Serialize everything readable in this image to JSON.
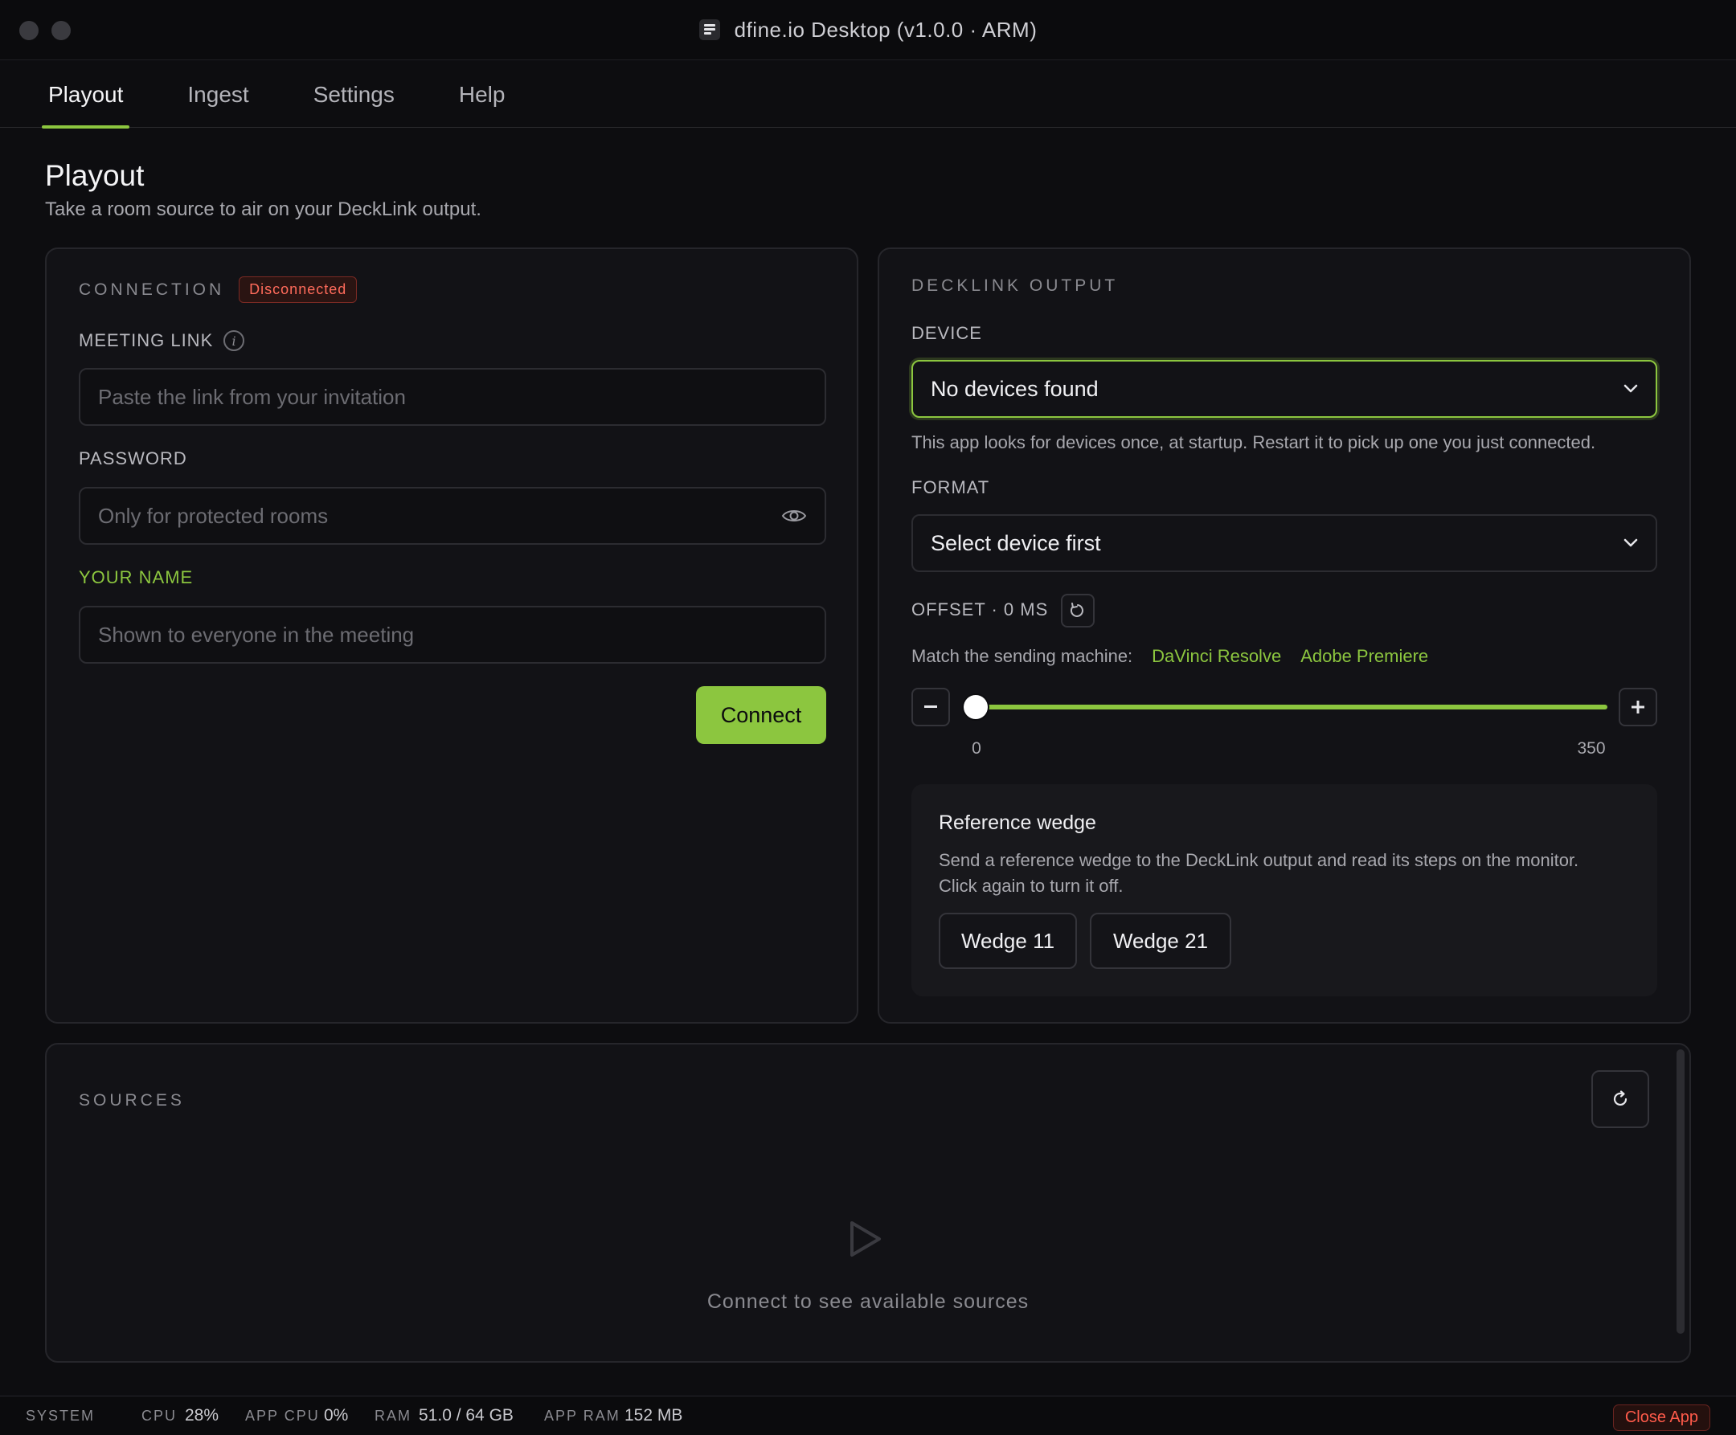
{
  "window": {
    "title": "dfine.io Desktop (v1.0.0 · ARM)"
  },
  "tabs": [
    {
      "label": "Playout"
    },
    {
      "label": "Ingest"
    },
    {
      "label": "Settings"
    },
    {
      "label": "Help"
    }
  ],
  "page": {
    "title": "Playout",
    "subtitle": "Take a room source to air on your DeckLink output."
  },
  "connection": {
    "section_label": "CONNECTION",
    "status_badge": "Disconnected",
    "meeting_link_label": "MEETING LINK",
    "meeting_link_placeholder": "Paste the link from your invitation",
    "password_label": "PASSWORD",
    "password_placeholder": "Only for protected rooms",
    "name_label": "YOUR NAME",
    "name_placeholder": "Shown to everyone in the meeting",
    "connect_label": "Connect"
  },
  "decklink": {
    "section_label": "DECKLINK OUTPUT",
    "device_label": "DEVICE",
    "device_value": "No devices found",
    "device_hint": "This app looks for devices once, at startup. Restart it to pick up one you just connected.",
    "format_label": "FORMAT",
    "format_value": "Select device first",
    "offset_label": "OFFSET · 0 MS",
    "match_label": "Match the sending machine:",
    "match_links": [
      "DaVinci Resolve",
      "Adobe Premiere"
    ],
    "slider": {
      "min": 0,
      "max": 350,
      "value": 0,
      "min_label": "0",
      "max_label": "350"
    },
    "wedge": {
      "title": "Reference wedge",
      "description_1": "Send a reference wedge to the DeckLink output and read its steps on the monitor.",
      "description_2": "Click again to turn it off.",
      "buttons": [
        "Wedge 11",
        "Wedge 21"
      ]
    }
  },
  "sources": {
    "section_label": "SOURCES",
    "empty_message": "Connect to see available sources"
  },
  "statusbar": {
    "system_label": "SYSTEM",
    "cpu_label": "CPU",
    "cpu_value": "28%",
    "app_cpu_label": "APP CPU",
    "app_cpu_value": "0%",
    "ram_label": "RAM",
    "ram_value": "51.0 / 64 GB",
    "app_ram_label": "APP RAM",
    "app_ram_value": "152 MB",
    "close_label": "Close App"
  },
  "colors": {
    "accent": "#8cc63f",
    "danger": "#ff5a4a",
    "background": "#0d0d10",
    "card": "#121216"
  }
}
